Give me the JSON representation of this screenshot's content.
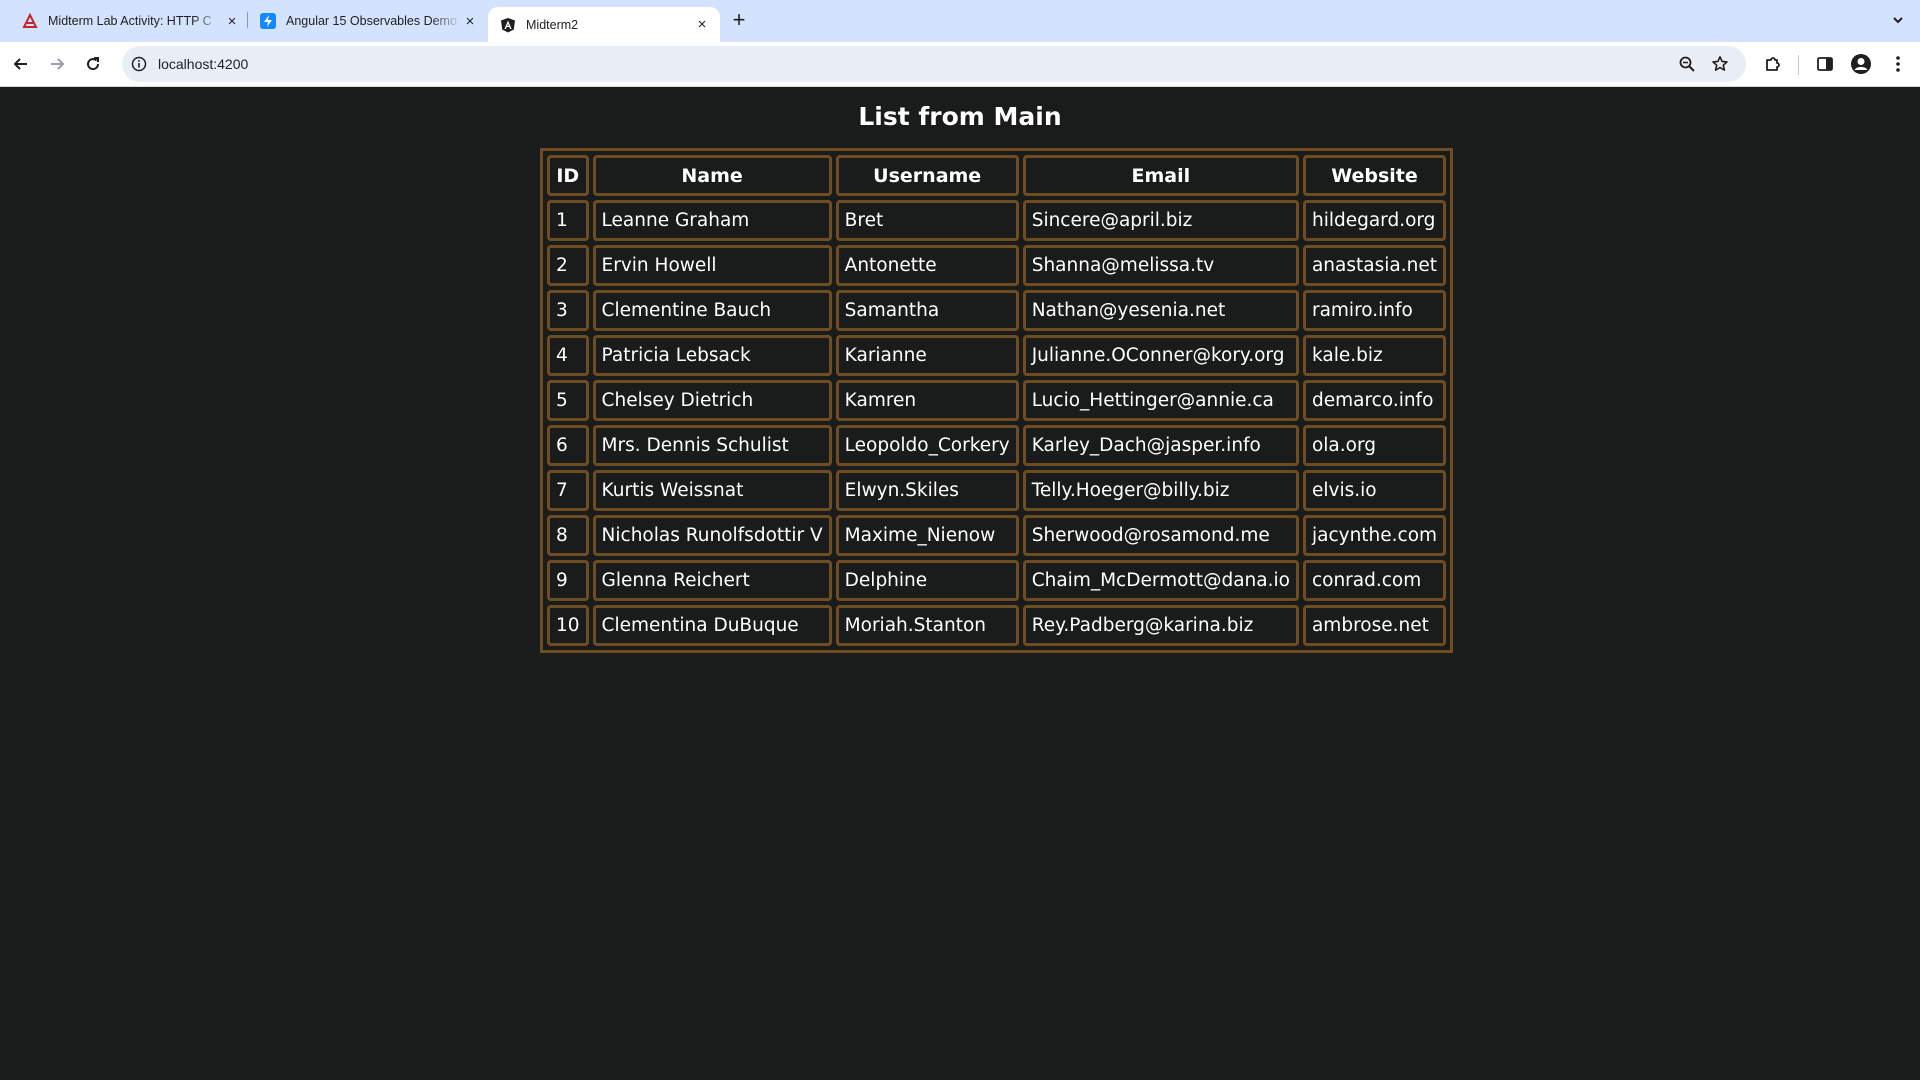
{
  "browser": {
    "tabs": [
      {
        "title": "Midterm Lab Activity: HTTP C",
        "active": false,
        "icon": "rubric-icon",
        "color": "#c5252a"
      },
      {
        "title": "Angular 15 Observables Demo",
        "active": false,
        "icon": "stackblitz-icon",
        "color": "#1389fd"
      },
      {
        "title": "Midterm2",
        "active": true,
        "icon": "angular-icon",
        "color": "#1f1f1f"
      }
    ],
    "url": "localhost:4200"
  },
  "page": {
    "title": "List from Main",
    "columns": [
      "ID",
      "Name",
      "Username",
      "Email",
      "Website"
    ],
    "rows": [
      {
        "id": "1",
        "name": "Leanne Graham",
        "username": "Bret",
        "email": "Sincere@april.biz",
        "website": "hildegard.org"
      },
      {
        "id": "2",
        "name": "Ervin Howell",
        "username": "Antonette",
        "email": "Shanna@melissa.tv",
        "website": "anastasia.net"
      },
      {
        "id": "3",
        "name": "Clementine Bauch",
        "username": "Samantha",
        "email": "Nathan@yesenia.net",
        "website": "ramiro.info"
      },
      {
        "id": "4",
        "name": "Patricia Lebsack",
        "username": "Karianne",
        "email": "Julianne.OConner@kory.org",
        "website": "kale.biz"
      },
      {
        "id": "5",
        "name": "Chelsey Dietrich",
        "username": "Kamren",
        "email": "Lucio_Hettinger@annie.ca",
        "website": "demarco.info"
      },
      {
        "id": "6",
        "name": "Mrs. Dennis Schulist",
        "username": "Leopoldo_Corkery",
        "email": "Karley_Dach@jasper.info",
        "website": "ola.org"
      },
      {
        "id": "7",
        "name": "Kurtis Weissnat",
        "username": "Elwyn.Skiles",
        "email": "Telly.Hoeger@billy.biz",
        "website": "elvis.io"
      },
      {
        "id": "8",
        "name": "Nicholas Runolfsdottir V",
        "username": "Maxime_Nienow",
        "email": "Sherwood@rosamond.me",
        "website": "jacynthe.com"
      },
      {
        "id": "9",
        "name": "Glenna Reichert",
        "username": "Delphine",
        "email": "Chaim_McDermott@dana.io",
        "website": "conrad.com"
      },
      {
        "id": "10",
        "name": "Clementina DuBuque",
        "username": "Moriah.Stanton",
        "email": "Rey.Padberg@karina.biz",
        "website": "ambrose.net"
      }
    ]
  },
  "colors": {
    "page_background": "#1a1b1b",
    "table_border": "#6e4d22",
    "tabstrip": "#d3e3fd"
  }
}
